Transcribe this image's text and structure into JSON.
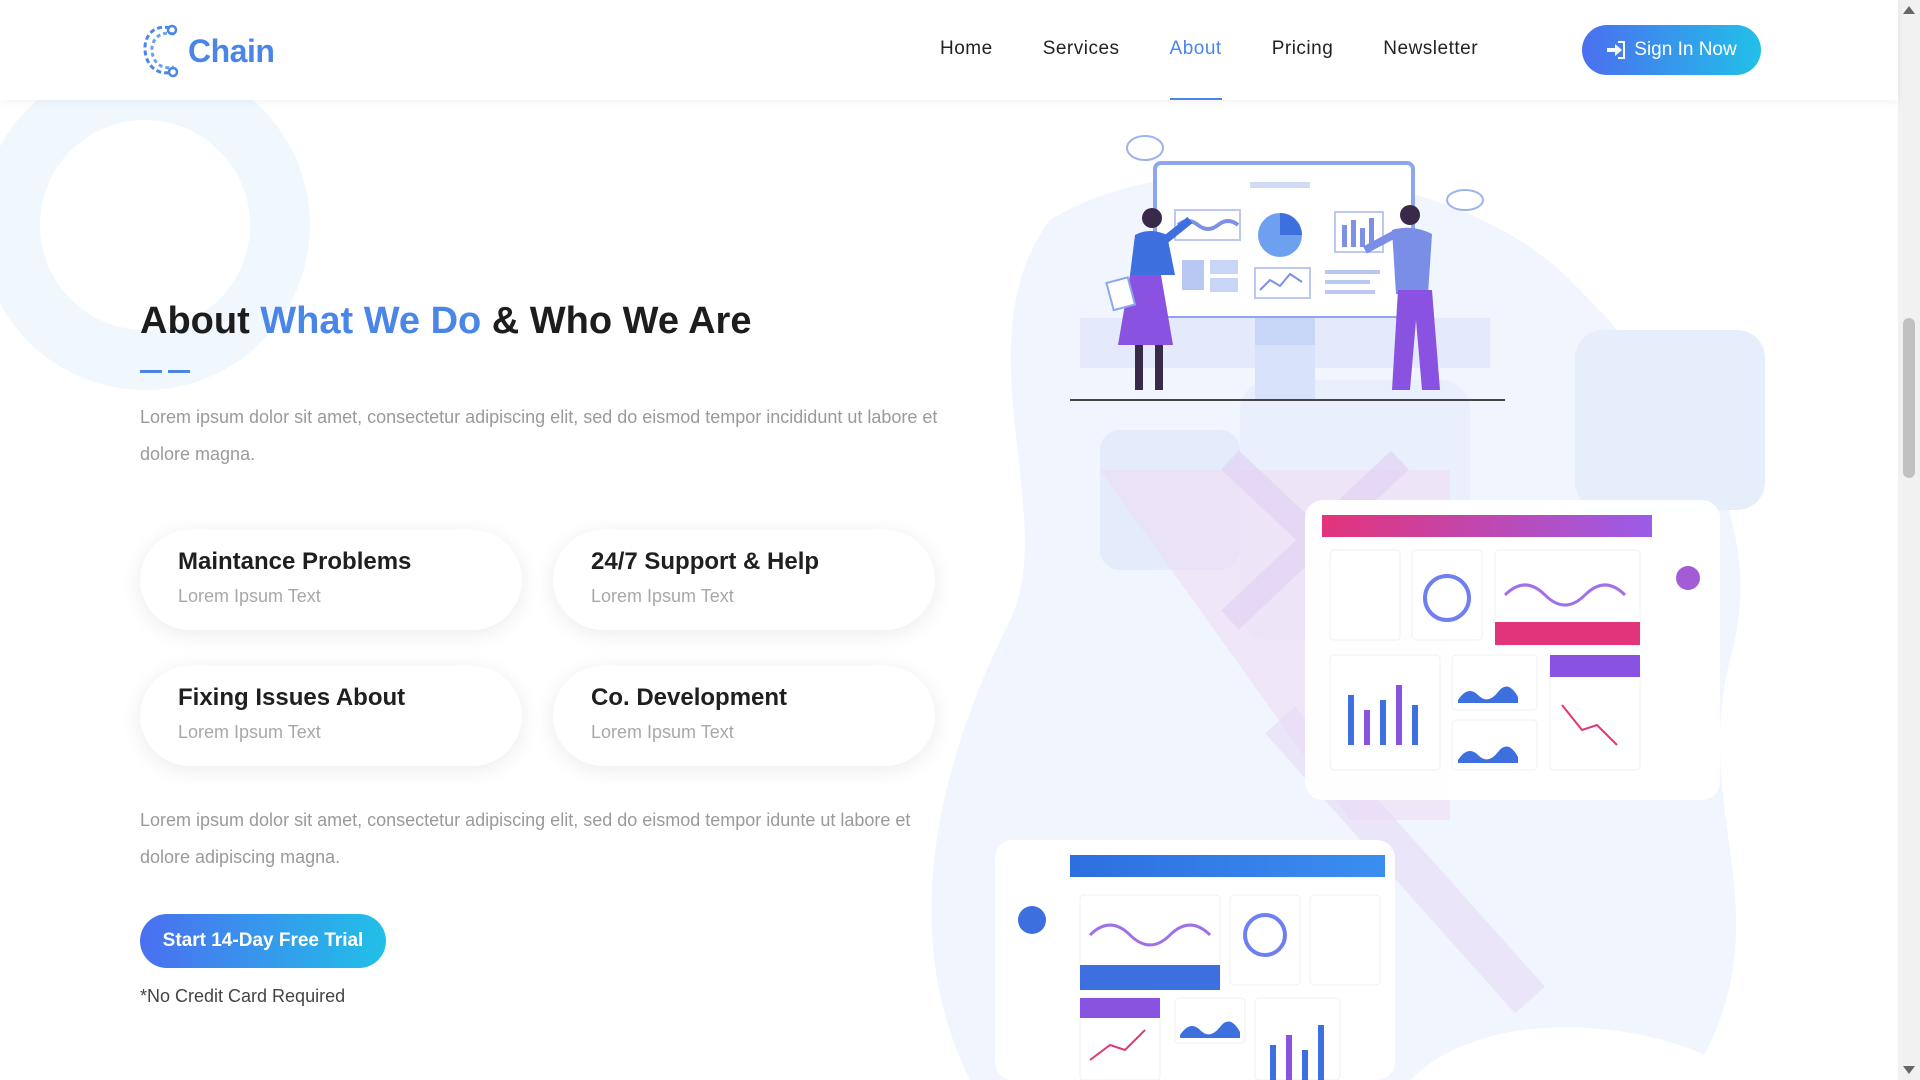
{
  "brand": {
    "name": "Chain"
  },
  "nav": {
    "items": [
      {
        "label": "Home"
      },
      {
        "label": "Services"
      },
      {
        "label": "About",
        "active": true
      },
      {
        "label": "Pricing"
      },
      {
        "label": "Newsletter"
      }
    ],
    "signin_label": "Sign In Now"
  },
  "hero": {
    "title_part1": "About ",
    "title_highlight": "What We Do",
    "title_part2": " & Who We Are",
    "paragraph1": "Lorem ipsum dolor sit amet, consectetur adipiscing elit, sed do eismod tempor incididunt ut labore et dolore magna.",
    "cards": [
      {
        "title": "Maintance Problems",
        "subtitle": "Lorem Ipsum Text"
      },
      {
        "title": "24/7 Support & Help",
        "subtitle": "Lorem Ipsum Text"
      },
      {
        "title": "Fixing Issues About",
        "subtitle": "Lorem Ipsum Text"
      },
      {
        "title": "Co. Development",
        "subtitle": "Lorem Ipsum Text"
      }
    ],
    "paragraph2": "Lorem ipsum dolor sit amet, consectetur adipiscing elit, sed do eismod tempor idunte ut labore et dolore adipiscing magna.",
    "cta_label": "Start 14-Day Free Trial",
    "cta_note": "*No Credit Card Required"
  },
  "colors": {
    "accent": "#4a86e8",
    "gradient_start": "#4b6ff0",
    "gradient_end": "#21c0e8"
  },
  "icons": {
    "logo": "chain-link-logo-icon",
    "signin": "sign-in-icon"
  }
}
